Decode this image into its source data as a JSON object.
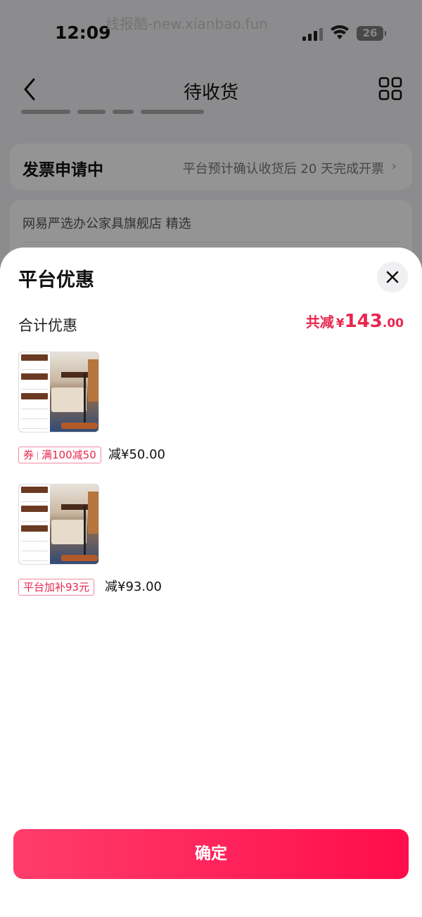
{
  "status_bar": {
    "time": "12:09",
    "battery": "26",
    "watermark": "线报酷-new.xianbao.fun"
  },
  "nav": {
    "title": "待收货",
    "icons": [
      "back-icon",
      "grid-icon"
    ]
  },
  "background": {
    "invoice_label": "发票申请中",
    "invoice_note": "平台预计确认收货后 20 天完成开票",
    "store_name": "网易严选办公家具旗舰店 精选"
  },
  "sheet": {
    "title": "平台优惠",
    "total_label": "合计优惠",
    "total_prefix": "共减",
    "total_yen": "¥",
    "total_int": "143",
    "total_dec": ".00",
    "items": [
      {
        "tag_prefix": "券",
        "tag_text": "满100减50",
        "reduce": "减¥50.00"
      },
      {
        "tag_text": "平台加补93元",
        "reduce": "减¥93.00"
      }
    ],
    "confirm_label": "确定"
  },
  "colors": {
    "accent": "#e8274f",
    "button_start": "#ff3d6c",
    "button_end": "#ff0d4d"
  }
}
